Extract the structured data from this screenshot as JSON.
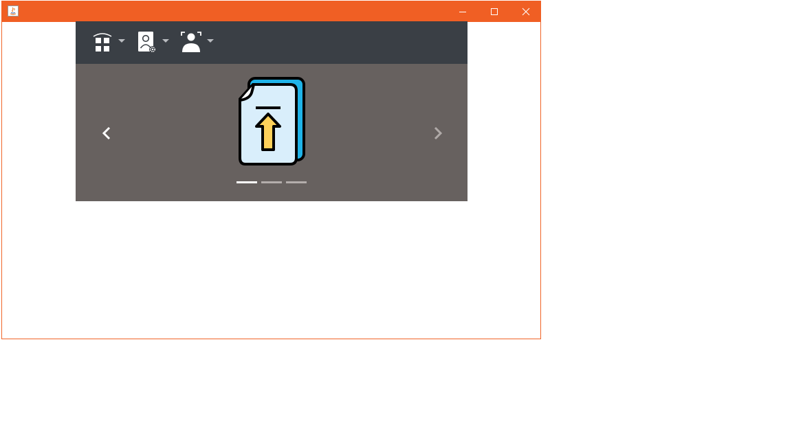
{
  "window": {
    "title": "",
    "accent_color": "#f05f24",
    "controls": {
      "minimize_icon": "minimize-icon",
      "maximize_icon": "maximize-icon",
      "close_icon": "close-icon"
    }
  },
  "toolbar": {
    "background": "#3a3f45",
    "items": [
      {
        "icon": "home-grid-icon",
        "has_dropdown": true
      },
      {
        "icon": "user-settings-icon",
        "has_dropdown": true
      },
      {
        "icon": "user-scan-icon",
        "has_dropdown": true
      }
    ]
  },
  "carousel": {
    "background": "#67615f",
    "prev_icon": "chevron-left-icon",
    "next_icon": "chevron-right-icon",
    "slide_icon": "file-upload-icon",
    "slide_count": 3,
    "active_index": 0
  }
}
